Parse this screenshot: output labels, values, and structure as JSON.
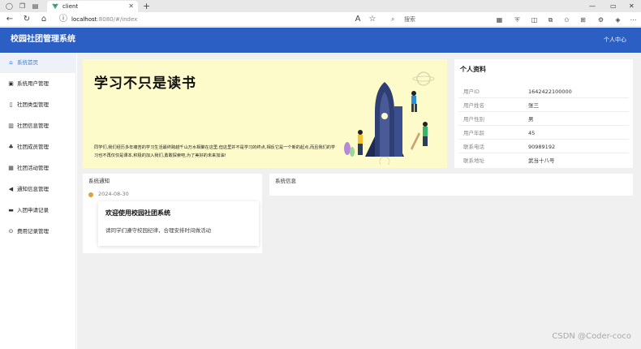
{
  "browser": {
    "tab_title": "client",
    "new_tab_icon": "plus",
    "url_host": "localhost",
    "url_path": ":8080/#/index",
    "search_placeholder": "搜索",
    "window_controls": [
      "—",
      "▭",
      "✕"
    ]
  },
  "header": {
    "brand": "校园社团管理系统",
    "user_menu": "个人中心"
  },
  "sidebar": {
    "items": [
      {
        "label": "系统首页",
        "icon": "home-icon",
        "active": true
      },
      {
        "label": "系统用户管理",
        "icon": "user-box-icon"
      },
      {
        "label": "社团类型管理",
        "icon": "doc-icon"
      },
      {
        "label": "社团信息管理",
        "icon": "building-icon"
      },
      {
        "label": "社团成员管理",
        "icon": "group-icon"
      },
      {
        "label": "社团活动管理",
        "icon": "calendar-icon"
      },
      {
        "label": "通知信息管理",
        "icon": "megaphone-icon"
      },
      {
        "label": "入团申请记录",
        "icon": "inbox-icon"
      },
      {
        "label": "费用记录管理",
        "icon": "coin-icon"
      }
    ]
  },
  "banner": {
    "headline": "学习不只是读书",
    "description": "同学们,我们经历多年痛苦的学习生活最终跨越千山万水相聚在这里,但这里并不是学习的终点,相反它是一个新的起点,而且我们的学习也不再仅仅是课本,积极的加入我们,勇敢探索吧,为了美好的未来加油!"
  },
  "profile": {
    "title": "个人资料",
    "rows": [
      {
        "key": "用户ID",
        "value": "1642422100000"
      },
      {
        "key": "用户姓名",
        "value": "张三"
      },
      {
        "key": "用户性别",
        "value": "男"
      },
      {
        "key": "用户年龄",
        "value": "45"
      },
      {
        "key": "联系电话",
        "value": "90989192"
      },
      {
        "key": "联系地址",
        "value": "武当十八号"
      }
    ]
  },
  "notice": {
    "title": "系统通知",
    "date": "2024-08-30",
    "card_title": "欢迎使用校园社团系统",
    "card_body": "请同学们遵守校园纪律，合理安排时间做活动"
  },
  "sysinfo": {
    "title": "系统信息"
  },
  "watermark": "CSDN @Coder-coco"
}
